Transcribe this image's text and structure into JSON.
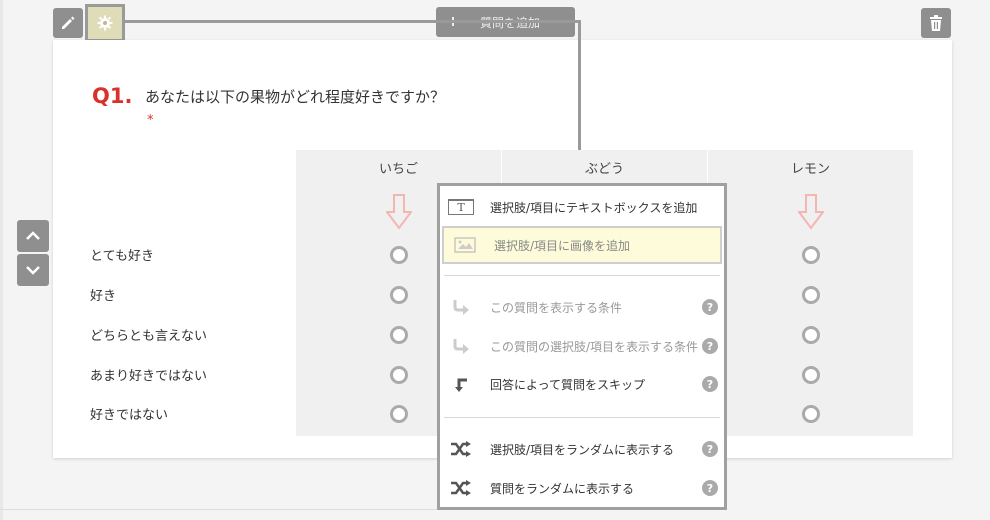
{
  "toolbar": {
    "add_question_plus": "+",
    "add_question_label": "質問を追加"
  },
  "question": {
    "number": "Q1.",
    "text": "あなたは以下の果物がどれ程度好きですか？",
    "required_mark": "*",
    "columns": [
      "いちご",
      "ぶどう",
      "レモン"
    ],
    "rows": [
      "とても好き",
      "好き",
      "どちらとも言えない",
      "あまり好きではない",
      "好きではない"
    ]
  },
  "menu": {
    "items": [
      {
        "label": "選択肢/項目にテキストボックスを追加",
        "icon": "textbox-icon",
        "disabled": false
      },
      {
        "label": "選択肢/項目に画像を追加",
        "icon": "image-icon",
        "disabled": true
      },
      {
        "label": "この質問を表示する条件",
        "icon": "branch-arrow-icon",
        "disabled": true,
        "help": true
      },
      {
        "label": "この質問の選択肢/項目を表示する条件",
        "icon": "branch-arrow-icon",
        "disabled": true,
        "help": true
      },
      {
        "label": "回答によって質問をスキップ",
        "icon": "skip-arrow-icon",
        "disabled": false,
        "help": true
      },
      {
        "label": "選択肢/項目をランダムに表示する",
        "icon": "shuffle-icon",
        "disabled": false,
        "help": true
      },
      {
        "label": "質問をランダムに表示する",
        "icon": "shuffle-icon",
        "disabled": false,
        "help": true
      }
    ],
    "help_mark": "?",
    "textbox_icon_glyph": "T"
  },
  "colors": {
    "accent_red": "#d9312b",
    "button_gray": "#8f8f8f",
    "highlight_yellow": "#fdfbd9",
    "gear_active": "#dfdcb8",
    "arrow_pink": "#f5b5b0"
  }
}
